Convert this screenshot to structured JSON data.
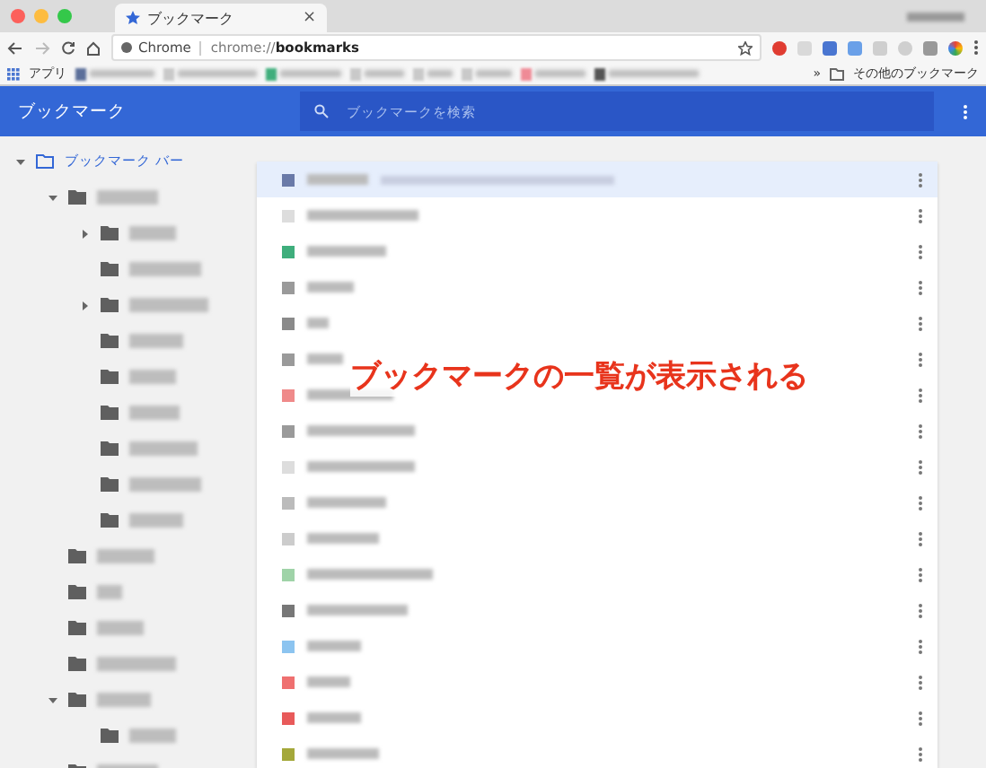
{
  "tab": {
    "title": "ブックマーク",
    "close": "×"
  },
  "address_bar": {
    "site_label": "Chrome",
    "url_prefix": "chrome://",
    "url_path": "bookmarks"
  },
  "bookmarks_bar": {
    "apps_label": "アプリ",
    "items": [
      {
        "color": "#5b6f9a"
      },
      {
        "color": "#c9c9c9"
      },
      {
        "color": "#3fae7c"
      },
      {
        "color": "#c9c9c9"
      },
      {
        "color": "#c9c9c9"
      },
      {
        "color": "#c9c9c9"
      },
      {
        "color": "#ef8a96"
      },
      {
        "color": "#555555"
      }
    ],
    "overflow": "»",
    "other_label": "その他のブックマーク"
  },
  "header": {
    "title": "ブックマーク",
    "search": {
      "placeholder": "ブックマークを検索"
    }
  },
  "sidebar": {
    "tree": [
      {
        "label": "ブックマーク バー",
        "selected": true,
        "expanded": true,
        "children": [
          {
            "selected": false,
            "expanded": true,
            "children": [
              {
                "selected": false,
                "expanded": false
              },
              {
                "selected": false
              },
              {
                "selected": false,
                "expanded": false
              },
              {
                "selected": false
              },
              {
                "selected": false
              },
              {
                "selected": false
              },
              {
                "selected": false
              },
              {
                "selected": false
              },
              {
                "selected": false
              }
            ]
          },
          {
            "selected": false
          },
          {
            "selected": false
          },
          {
            "selected": false
          },
          {
            "selected": false
          },
          {
            "selected": false,
            "expanded": true,
            "children": [
              {
                "selected": false
              }
            ]
          },
          {
            "selected": false
          }
        ]
      }
    ]
  },
  "list": {
    "annotation": "ブックマークの一覧が表示される",
    "rows": [
      {
        "selected": true,
        "color": "#6a7aa8"
      },
      {
        "selected": false,
        "color": "#dddddd"
      },
      {
        "selected": false,
        "color": "#3fae7c"
      },
      {
        "selected": false,
        "color": "#9a9a9a"
      },
      {
        "selected": false,
        "color": "#8a8a8a"
      },
      {
        "selected": false,
        "color": "#9a9a9a"
      },
      {
        "selected": false,
        "color": "#ef8a8a"
      },
      {
        "selected": false,
        "color": "#9a9a9a"
      },
      {
        "selected": false,
        "color": "#dddddd"
      },
      {
        "selected": false,
        "color": "#bbbbbb"
      },
      {
        "selected": false,
        "color": "#cccccc"
      },
      {
        "selected": false,
        "color": "#9fd3a8"
      },
      {
        "selected": false,
        "color": "#777777"
      },
      {
        "selected": false,
        "color": "#8cc4f0"
      },
      {
        "selected": false,
        "color": "#ef7070"
      },
      {
        "selected": false,
        "color": "#e85a5a"
      },
      {
        "selected": false,
        "color": "#a4a83a"
      }
    ]
  }
}
